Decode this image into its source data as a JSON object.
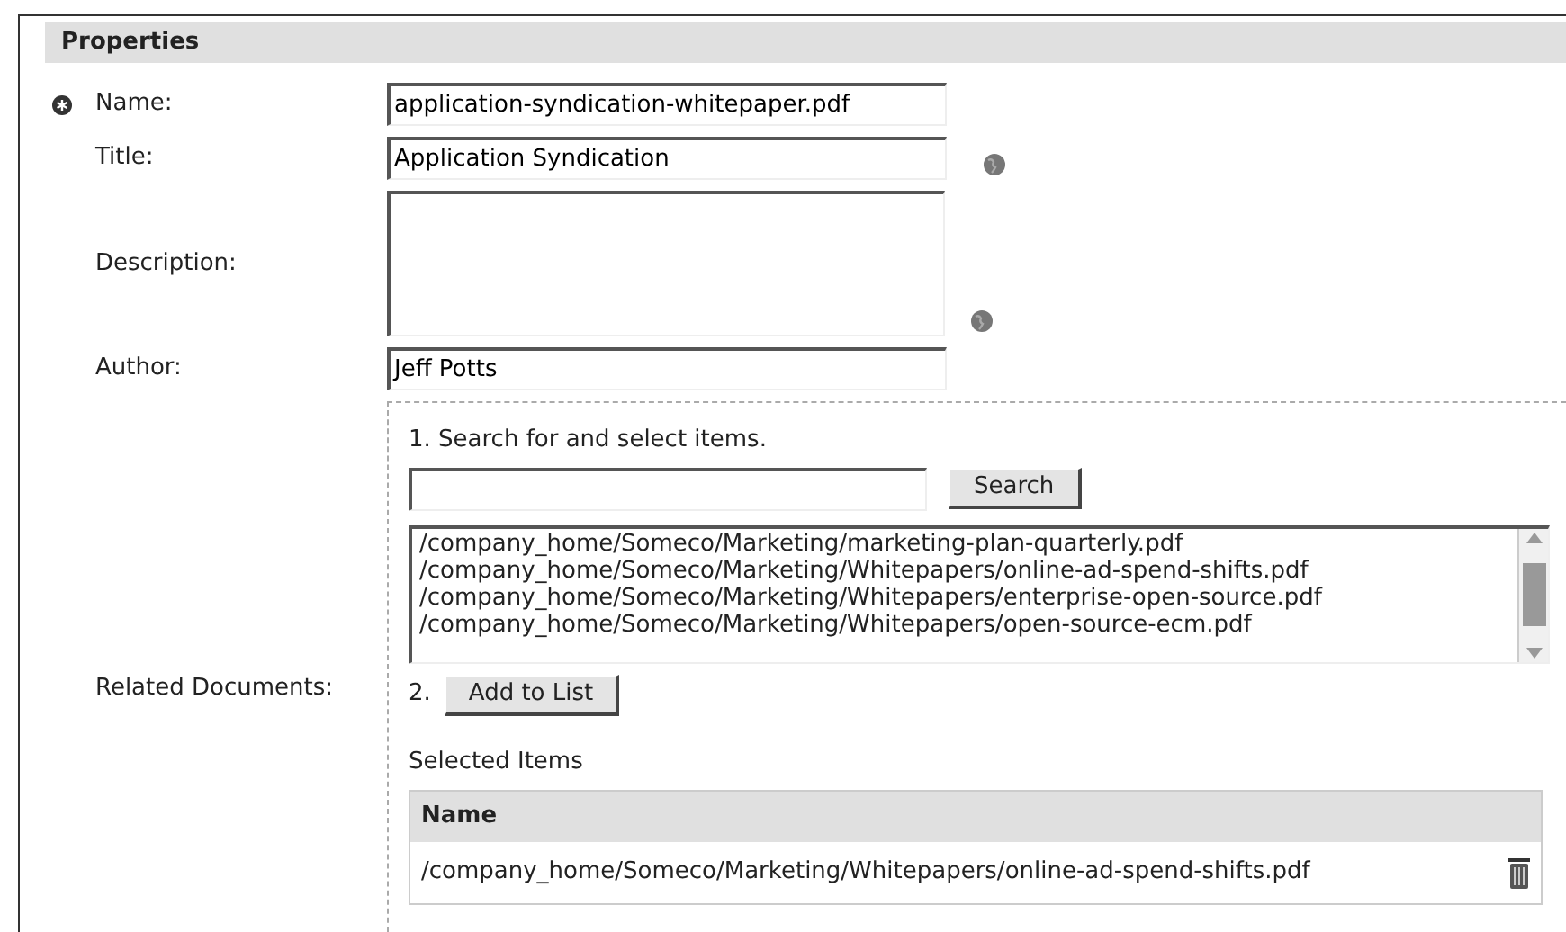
{
  "panel": {
    "title": "Properties"
  },
  "fields": [
    {
      "kind": "text",
      "label": "Name:",
      "value": "application-syndication-whitepaper.pdf",
      "required": true,
      "multilingual": false
    },
    {
      "kind": "text",
      "label": "Title:",
      "value": "Application Syndication",
      "required": false,
      "multilingual": true
    },
    {
      "kind": "textarea",
      "label": "Description:",
      "required": false,
      "multilingual": true
    },
    {
      "kind": "text",
      "label": "Author:",
      "value": "Jeff Potts",
      "required": false,
      "multilingual": false
    }
  ],
  "related": {
    "label": "Related Documents:",
    "step1": "1. Search for and select items.",
    "search_button": "Search",
    "results": [
      "/company_home/Someco/Marketing/marketing-plan-quarterly.pdf",
      "/company_home/Someco/Marketing/Whitepapers/online-ad-spend-shifts.pdf",
      "/company_home/Someco/Marketing/Whitepapers/enterprise-open-source.pdf",
      "/company_home/Someco/Marketing/Whitepapers/open-source-ecm.pdf"
    ],
    "step2": "2.",
    "add_button": "Add to List",
    "selected_label": "Selected Items",
    "table": {
      "columns": [
        "Name"
      ],
      "rows": [
        {
          "name": "/company_home/Someco/Marketing/Whitepapers/online-ad-spend-shifts.pdf"
        }
      ]
    }
  }
}
